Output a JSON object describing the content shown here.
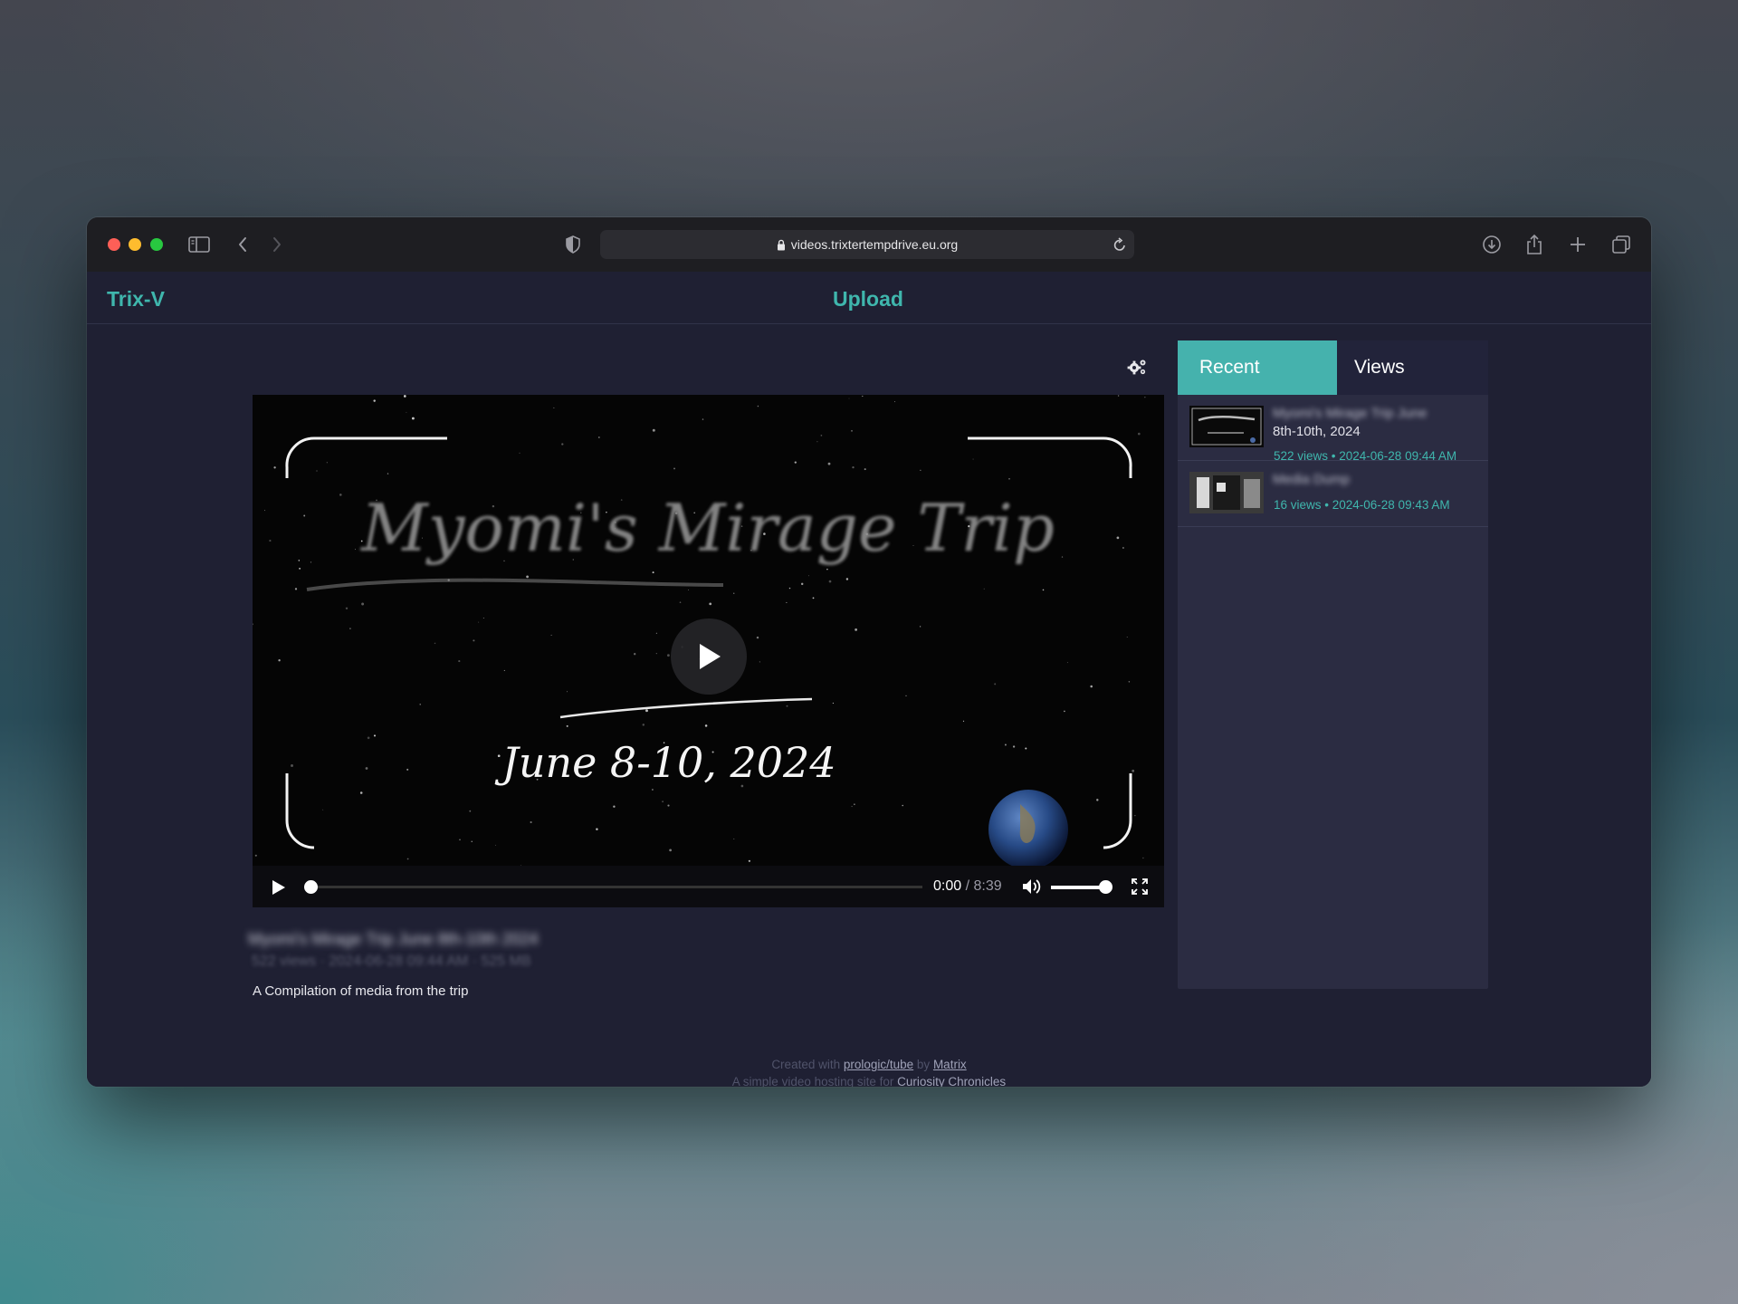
{
  "browser": {
    "url": "videos.trixtertempdrive.eu.org"
  },
  "navbar": {
    "brand": "Trix-V",
    "upload_label": "Upload"
  },
  "video": {
    "frame_title": "Myomi's Mirage Trip",
    "frame_date": "June 8-10, 2024",
    "current_time": "0:00",
    "separator": " / ",
    "duration": "8:39",
    "progress": 0.0,
    "volume": 0.9,
    "title": "Myomi's Mirage Trip June 8th-10th 2024",
    "meta": "522 views · 2024-06-28 09:44 AM · 525 MB",
    "description": "A Compilation of media from the trip"
  },
  "sidebar": {
    "tabs": [
      {
        "label": "Recent",
        "active": true
      },
      {
        "label": "Views",
        "active": false
      }
    ],
    "items": [
      {
        "title": "Myomi's Mirage Trip June",
        "subtitle": "8th-10th, 2024",
        "meta": "522 views • 2024-06-28 09:44 AM"
      },
      {
        "title": "Media Dump",
        "subtitle": "",
        "meta": "16 views • 2024-06-28 09:43 AM"
      }
    ]
  },
  "footer": {
    "line1_prefix": "Created with ",
    "line1_link1": "prologic/tube",
    "line1_mid": " by ",
    "line1_link2": "Matrix",
    "line2_prefix": "A simple video hosting site for ",
    "line2_link": "Curiosity Chronicles"
  },
  "colors": {
    "accent": "#3fb6ad",
    "page_bg": "#1f2033",
    "sidebar_bg": "#2b2c42"
  }
}
